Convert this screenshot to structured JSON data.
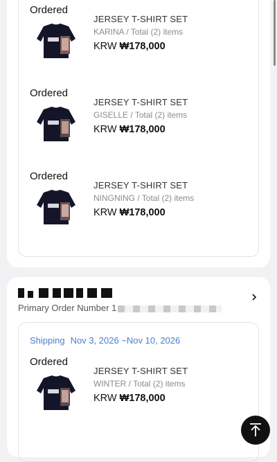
{
  "orders_top": [
    {
      "status": "Ordered",
      "name": "JERSEY T-SHIRT SET",
      "variant": "KARINA / Total (2) items",
      "currency": "KRW",
      "price": "₩178,000"
    },
    {
      "status": "Ordered",
      "name": "JERSEY T-SHIRT SET",
      "variant": "GISELLE / Total (2) items",
      "currency": "KRW",
      "price": "₩178,000"
    },
    {
      "status": "Ordered",
      "name": "JERSEY T-SHIRT SET",
      "variant": "NINGNING / Total (2) items",
      "currency": "KRW",
      "price": "₩178,000"
    }
  ],
  "second_order": {
    "primary_order_label": "Primary Order Number 1",
    "shipping_label": "Shipping",
    "shipping_dates": "Nov 3, 2026 ~Nov 10, 2026",
    "item": {
      "status": "Ordered",
      "name": "JERSEY T-SHIRT SET",
      "variant": "WINTER / Total (2) items",
      "currency": "KRW",
      "price": "₩178,000"
    }
  },
  "icons": {
    "chevron": "chevron-right-icon",
    "totop": "arrow-up-to-top-icon"
  }
}
